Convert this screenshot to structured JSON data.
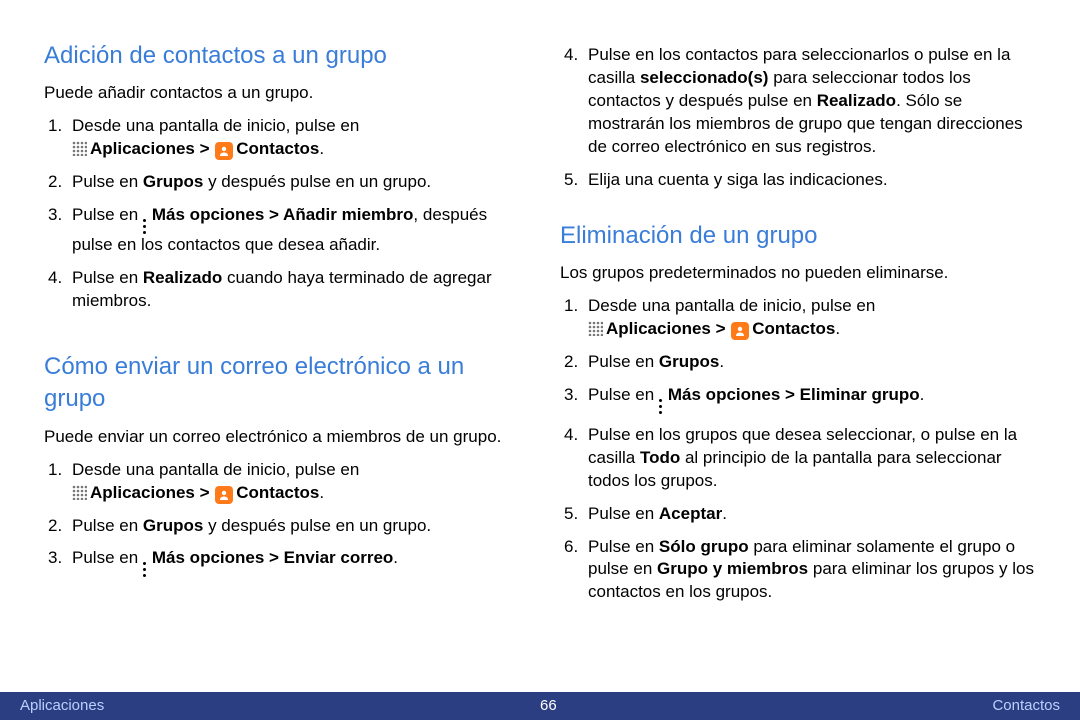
{
  "sec1": {
    "title": "Adición de contactos a un grupo",
    "intro": "Puede añadir contactos a un grupo.",
    "s1a": "Desde una pantalla de inicio, pulse en",
    "apps_label": "Aplicaciones > ",
    "contacts_label": "Contactos",
    "period": ".",
    "s2a": "Pulse en ",
    "s2b": "Grupos",
    "s2c": " y después pulse en un grupo.",
    "s3a": "Pulse en ",
    "s3b": "Más opciones > Añadir miembro",
    "s3c": ", después pulse en los contactos que desea añadir.",
    "s4a": "Pulse en ",
    "s4b": "Realizado",
    "s4c": " cuando haya terminado de agregar miembros."
  },
  "sec2": {
    "title": "Cómo enviar un correo electrónico a un grupo",
    "intro": "Puede enviar un correo electrónico a miembros de un grupo.",
    "s1a": "Desde una pantalla de inicio, pulse en",
    "apps_label": "Aplicaciones > ",
    "contacts_label": "Contactos",
    "period": ".",
    "s2a": "Pulse en ",
    "s2b": "Grupos",
    "s2c": " y después pulse en un grupo.",
    "s3a": "Pulse en ",
    "s3b": "Más opciones > Enviar correo",
    "s3c": "."
  },
  "sec2b": {
    "s4a": "Pulse en los contactos para seleccionarlos o pulse en la casilla ",
    "s4b": "seleccionado(s)",
    "s4c": " para seleccionar todos los contactos y después pulse en ",
    "s4d": "Realizado",
    "s4e": ". Sólo se mostrarán los miembros de grupo que tengan direcciones de correo electrónico en sus registros.",
    "s5": "Elija una cuenta y siga las indicaciones."
  },
  "sec3": {
    "title": "Eliminación de un grupo",
    "intro": "Los grupos predeterminados no pueden eliminarse.",
    "s1a": "Desde una pantalla de inicio, pulse en",
    "apps_label": "Aplicaciones > ",
    "contacts_label": "Contactos",
    "period": ".",
    "s2a": "Pulse en ",
    "s2b": "Grupos",
    "s2c": ".",
    "s3a": "Pulse en ",
    "s3b": "Más opciones > Eliminar grupo",
    "s3c": ".",
    "s4a": "Pulse en los grupos que desea seleccionar, o pulse en la casilla ",
    "s4b": "Todo",
    "s4c": " al principio de la pantalla para seleccionar todos los grupos.",
    "s5a": "Pulse en ",
    "s5b": "Aceptar",
    "s5c": ".",
    "s6a": "Pulse en ",
    "s6b": "Sólo grupo",
    "s6c": " para eliminar solamente el grupo o pulse en ",
    "s6d": "Grupo y miembros",
    "s6e": " para eliminar los grupos y los contactos en los grupos."
  },
  "footer": {
    "left": "Aplicaciones",
    "page": "66",
    "right": "Contactos"
  }
}
